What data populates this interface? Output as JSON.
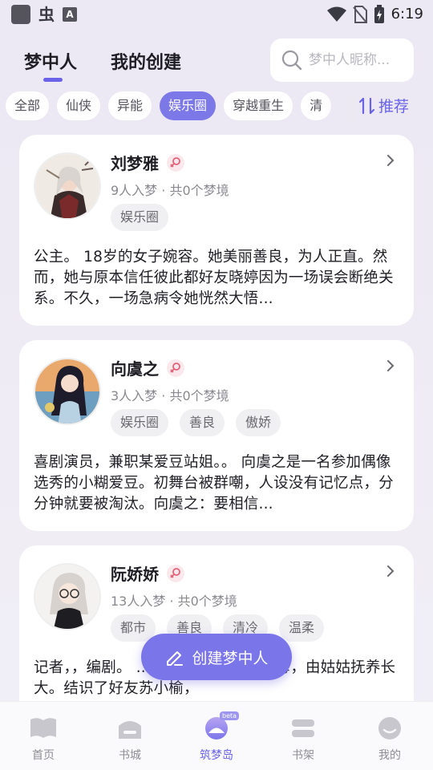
{
  "status_bar": {
    "time": "6:19",
    "app_glyph": "虫",
    "app_letter": "A"
  },
  "header": {
    "tabs": [
      {
        "label": "梦中人",
        "active": true
      },
      {
        "label": "我的创建",
        "active": false
      }
    ],
    "search_placeholder": "梦中人昵称..."
  },
  "filters": {
    "chips": [
      {
        "label": "全部",
        "active": false
      },
      {
        "label": "仙侠",
        "active": false
      },
      {
        "label": "异能",
        "active": false
      },
      {
        "label": "娱乐圈",
        "active": true
      },
      {
        "label": "穿越重生",
        "active": false
      },
      {
        "label": "清",
        "active": false
      }
    ],
    "sort_label": "推荐"
  },
  "characters": [
    {
      "name": "刘梦雅",
      "stats": "9人入梦 · 共0个梦境",
      "tags": [
        "娱乐圈"
      ],
      "description": "公主。 18岁的女子婉容。她美丽善良，为人正直。然而，她与原本信任彼此都好友晓婷因为一场误会断绝关系。不久，一场急病令她恍然大悟..."
    },
    {
      "name": "向虞之",
      "stats": "3人入梦 · 共0个梦境",
      "tags": [
        "娱乐圈",
        "善良",
        "傲娇"
      ],
      "description": "喜剧演员，兼职某爱豆站姐。。 向虞之是一名参加偶像选秀的小糊爱豆。初舞台被群嘲，人设没有记忆点，分分钟就要被淘汰。向虞之：要相信..."
    },
    {
      "name": "阮娇娇",
      "stats": "13人入梦 · 共0个梦境",
      "tags": [
        "都市",
        "善良",
        "清冷",
        "温柔"
      ],
      "description": "记者，，编剧。 ... 不断。从小失去父母，由姑姑抚养长大。结识了好友苏小榆，"
    }
  ],
  "fab": {
    "label": "创建梦中人"
  },
  "bottom_nav": [
    {
      "label": "首页",
      "icon": "home-book-icon",
      "active": false
    },
    {
      "label": "书城",
      "icon": "bookstore-icon",
      "active": false
    },
    {
      "label": "筑梦岛",
      "icon": "dream-island-icon",
      "active": true,
      "badge": "beta"
    },
    {
      "label": "书架",
      "icon": "bookshelf-icon",
      "active": false
    },
    {
      "label": "我的",
      "icon": "profile-icon",
      "active": false
    }
  ],
  "colors": {
    "accent": "#6a63e8",
    "chip_active": "#7d78e8",
    "female_icon": "#e2607a"
  }
}
